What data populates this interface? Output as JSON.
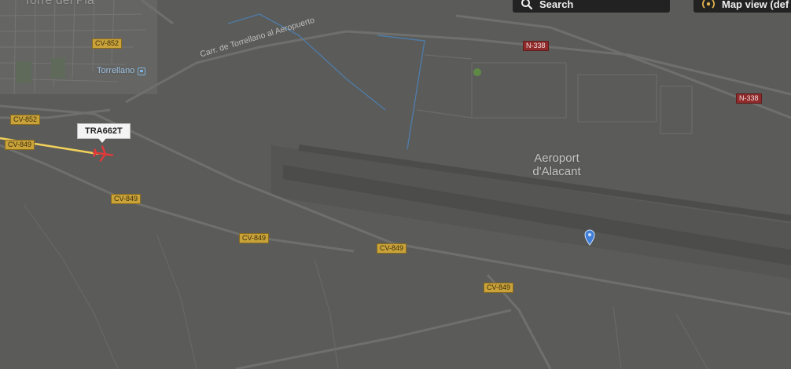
{
  "map": {
    "place_top": "Torre del Pla",
    "station": "Torrellano",
    "street": "Carr. de Torrellano al Aeropuerto",
    "airport_line1": "Aeroport",
    "airport_line2": "d'Alacant"
  },
  "roads": {
    "cv852_a": "CV-852",
    "cv852_b": "CV-852",
    "cv849_a": "CV-849",
    "cv849_b": "CV-849",
    "cv849_c": "CV-849",
    "cv849_d": "CV-849",
    "cv849_e": "CV-849",
    "n338_a": "N-338",
    "n338_b": "N-338"
  },
  "toolbar": {
    "search_label": "Search",
    "mapview_label": "Map view (def"
  },
  "flight": {
    "callsign": "TRA662T",
    "track_color": "#f2d25a",
    "plane_color": "#e03a3a"
  },
  "colors": {
    "background": "#5b5b59",
    "runway": "#4c4c4b",
    "road_label": "#c9a23a",
    "national_road_label": "#8f2b2b",
    "water": "#4f7ba6",
    "pin": "#3f7fd8"
  },
  "icons": {
    "search": "magnifier-icon",
    "mapview": "broadcast-icon",
    "aircraft": "plane-icon",
    "location": "map-pin-icon",
    "station": "train-station-icon"
  }
}
